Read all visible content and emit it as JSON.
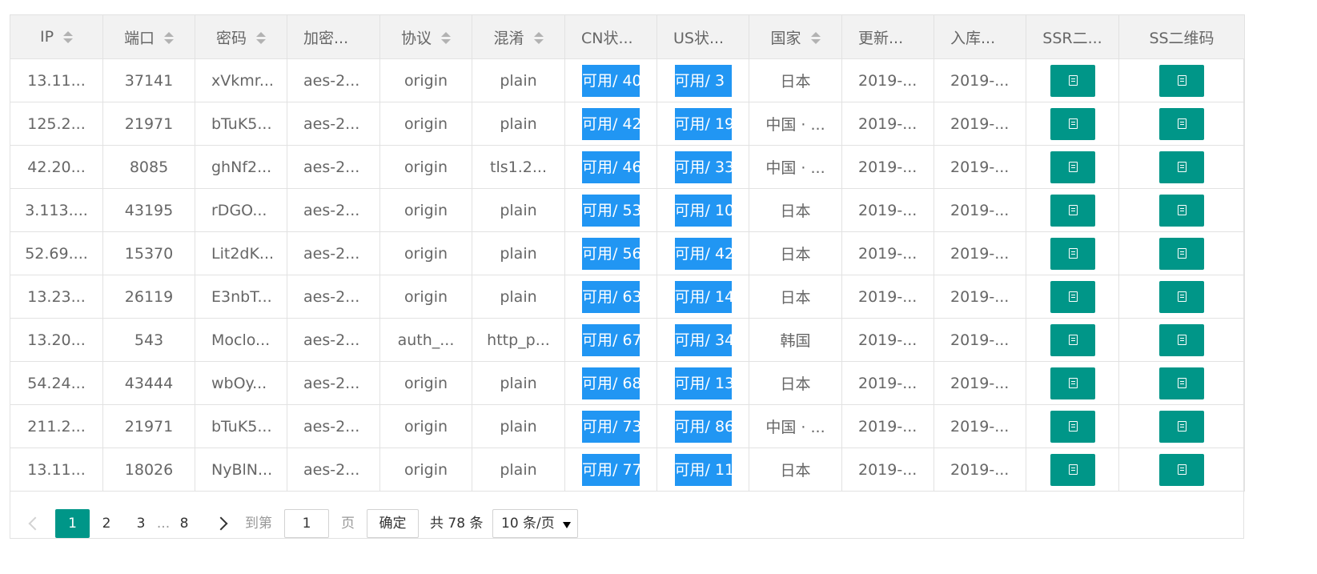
{
  "columns": [
    {
      "label": "IP",
      "sortable": true
    },
    {
      "label": "端口",
      "sortable": true
    },
    {
      "label": "密码",
      "sortable": true
    },
    {
      "label": "加密...",
      "sortable": false
    },
    {
      "label": "协议",
      "sortable": true
    },
    {
      "label": "混淆",
      "sortable": true
    },
    {
      "label": "CN状...",
      "sortable": false
    },
    {
      "label": "US状...",
      "sortable": false
    },
    {
      "label": "国家",
      "sortable": true
    },
    {
      "label": "更新...",
      "sortable": false
    },
    {
      "label": "入库...",
      "sortable": false
    },
    {
      "label": "SSR二...",
      "sortable": false
    },
    {
      "label": "SS二维码",
      "sortable": false
    }
  ],
  "rows": [
    {
      "ip": "13.11...",
      "port": "37141",
      "password": "xVkmr...",
      "method": "aes-2...",
      "protocol": "origin",
      "obfs": "plain",
      "cn": "可用/ 40",
      "us": "可用/ 3",
      "country": "日本",
      "updated": "2019-...",
      "stored": "2019-..."
    },
    {
      "ip": "125.2...",
      "port": "21971",
      "password": "bTuK5...",
      "method": "aes-2...",
      "protocol": "origin",
      "obfs": "plain",
      "cn": "可用/ 42",
      "us": "可用/ 19",
      "country": "中国 · ...",
      "updated": "2019-...",
      "stored": "2019-..."
    },
    {
      "ip": "42.20...",
      "port": "8085",
      "password": "ghNf2...",
      "method": "aes-2...",
      "protocol": "origin",
      "obfs": "tls1.2...",
      "cn": "可用/ 46",
      "us": "可用/ 33",
      "country": "中国 · ...",
      "updated": "2019-...",
      "stored": "2019-..."
    },
    {
      "ip": "3.113....",
      "port": "43195",
      "password": "rDGO...",
      "method": "aes-2...",
      "protocol": "origin",
      "obfs": "plain",
      "cn": "可用/ 53",
      "us": "可用/ 10",
      "country": "日本",
      "updated": "2019-...",
      "stored": "2019-..."
    },
    {
      "ip": "52.69....",
      "port": "15370",
      "password": "Lit2dK...",
      "method": "aes-2...",
      "protocol": "origin",
      "obfs": "plain",
      "cn": "可用/ 56",
      "us": "可用/ 42",
      "country": "日本",
      "updated": "2019-...",
      "stored": "2019-..."
    },
    {
      "ip": "13.23...",
      "port": "26119",
      "password": "E3nbT...",
      "method": "aes-2...",
      "protocol": "origin",
      "obfs": "plain",
      "cn": "可用/ 63",
      "us": "可用/ 14",
      "country": "日本",
      "updated": "2019-...",
      "stored": "2019-..."
    },
    {
      "ip": "13.20...",
      "port": "543",
      "password": "Moclo...",
      "method": "aes-2...",
      "protocol": "auth_...",
      "obfs": "http_p...",
      "cn": "可用/ 67",
      "us": "可用/ 34",
      "country": "韩国",
      "updated": "2019-...",
      "stored": "2019-..."
    },
    {
      "ip": "54.24...",
      "port": "43444",
      "password": "wbOy...",
      "method": "aes-2...",
      "protocol": "origin",
      "obfs": "plain",
      "cn": "可用/ 68",
      "us": "可用/ 13",
      "country": "日本",
      "updated": "2019-...",
      "stored": "2019-..."
    },
    {
      "ip": "211.2...",
      "port": "21971",
      "password": "bTuK5...",
      "method": "aes-2...",
      "protocol": "origin",
      "obfs": "plain",
      "cn": "可用/ 73",
      "us": "可用/ 86",
      "country": "中国 · ...",
      "updated": "2019-...",
      "stored": "2019-..."
    },
    {
      "ip": "13.11...",
      "port": "18026",
      "password": "NyBlN...",
      "method": "aes-2...",
      "protocol": "origin",
      "obfs": "plain",
      "cn": "可用/ 77",
      "us": "可用/ 11",
      "country": "日本",
      "updated": "2019-...",
      "stored": "2019-..."
    }
  ],
  "pagination": {
    "pages": [
      "1",
      "2",
      "3",
      "...",
      "8"
    ],
    "current": "1",
    "goto_label": "到第",
    "goto_value": "1",
    "page_unit": "页",
    "confirm_label": "确定",
    "total_label": "共 78 条",
    "page_size": "10 条/页"
  },
  "icons": {
    "prev": "chevron-left-icon",
    "next": "chevron-right-icon",
    "qr": "document-icon"
  },
  "colors": {
    "accent": "#009688",
    "status_bg": "#2196f3",
    "header_bg": "#f2f2f2",
    "border": "#e2e2e2"
  }
}
